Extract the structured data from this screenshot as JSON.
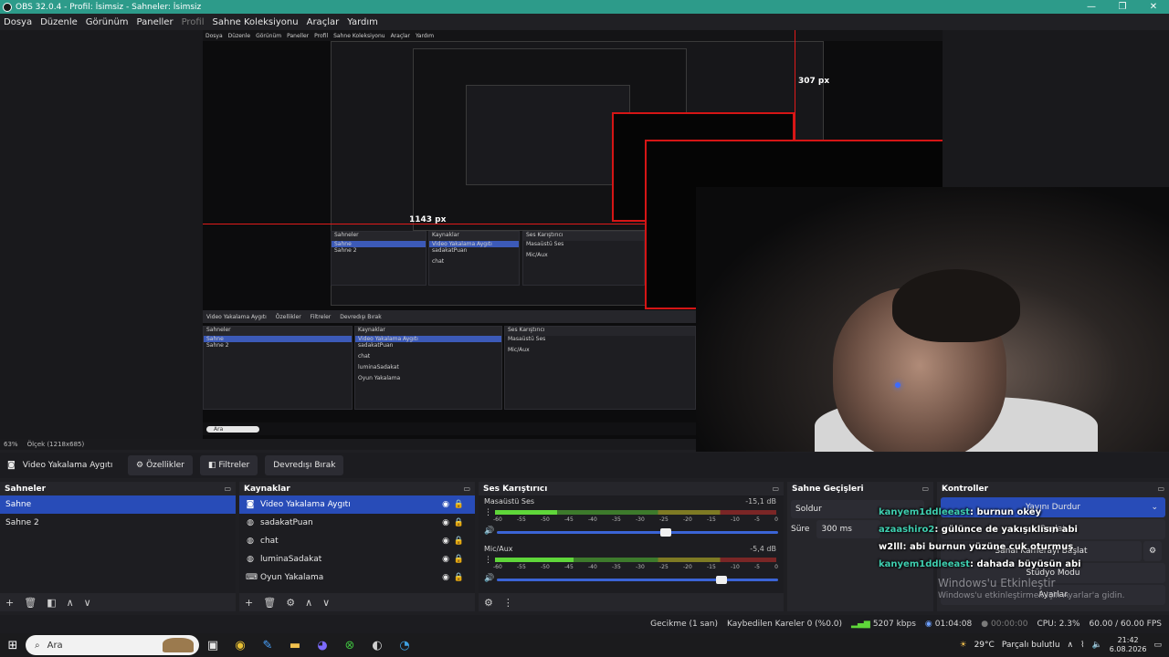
{
  "window": {
    "title": "OBS 32.0.4 - Profil: İsimsiz - Sahneler: İsimsiz"
  },
  "menu": {
    "items": [
      {
        "label": "Dosya",
        "disabled": false
      },
      {
        "label": "Düzenle",
        "disabled": false
      },
      {
        "label": "Görünüm",
        "disabled": false
      },
      {
        "label": "Paneller",
        "disabled": false
      },
      {
        "label": "Profil",
        "disabled": true
      },
      {
        "label": "Sahne Koleksiyonu",
        "disabled": false
      },
      {
        "label": "Araçlar",
        "disabled": false
      },
      {
        "label": "Yardım",
        "disabled": false
      }
    ]
  },
  "preview": {
    "measure_1143": "1143 px",
    "measure_307": "307 px",
    "zoom": "63%",
    "scale_label": "Ölçek (1218x685)"
  },
  "context": {
    "source": "Video Yakalama Aygıtı",
    "properties": "Özellikler",
    "filters": "Filtreler",
    "deactivate": "Devredışı Bırak"
  },
  "scenes": {
    "title": "Sahneler",
    "items": [
      "Sahne",
      "Sahne 2"
    ]
  },
  "sources": {
    "title": "Kaynaklar",
    "items": [
      "Video Yakalama Aygıtı",
      "sadakatPuan",
      "chat",
      "luminaSadakat",
      "Oyun Yakalama"
    ]
  },
  "mixer": {
    "title": "Ses Karıştırıcı",
    "channels": [
      {
        "name": "Masaüstü Ses",
        "db": "-15,1 dB",
        "level": 0.22,
        "volume": 0.6
      },
      {
        "name": "Mic/Aux",
        "db": "-5,4 dB",
        "level": 0.28,
        "volume": 0.8
      }
    ],
    "scale": [
      "-60",
      "-55",
      "-50",
      "-45",
      "-40",
      "-35",
      "-30",
      "-25",
      "-20",
      "-15",
      "-10",
      "-5",
      "0"
    ]
  },
  "transitions": {
    "title": "Sahne Geçişleri",
    "selected": "Soldur",
    "duration_label": "Süre",
    "duration_value": "300 ms"
  },
  "controls": {
    "title": "Kontroller",
    "stop_stream": "Yayını Durdur",
    "start_record": "Başlat",
    "virtual_camera": "Sanal Kamerayı Başlat",
    "studio_mode": "Stüdyo Modu",
    "settings": "Ayarlar"
  },
  "chat": [
    {
      "user": "kanyem1ddleeast",
      "msg": ": burnun okey"
    },
    {
      "user": "azaashiro2",
      "msg": ": gülünce de yakışıklısın abi"
    },
    {
      "user": "w2lll",
      "msg": ": abi burnun yüzüne cuk oturmuş"
    },
    {
      "user": "kanyem1ddleeast",
      "msg": ": dahada büyüsün abi"
    }
  ],
  "watermark": {
    "title": "Windows'u Etkinleştir",
    "sub": "Windows'u etkinleştirmek için Ayarlar'a gidin."
  },
  "status": {
    "delay": "Gecikme (1 san)",
    "dropped": "Kaybedilen Kareler 0 (%0.0)",
    "bitrate": "5207 kbps",
    "stream_time": "01:04:08",
    "record_time": "00:00:00",
    "cpu": "CPU: 2.3%",
    "fps": "60.00 / 60.00 FPS"
  },
  "taskbar": {
    "search": "Ara",
    "weather": "29°C",
    "weather_text": "Parçalı bulutlu",
    "time": "21:42",
    "date": "6.08.2026"
  }
}
